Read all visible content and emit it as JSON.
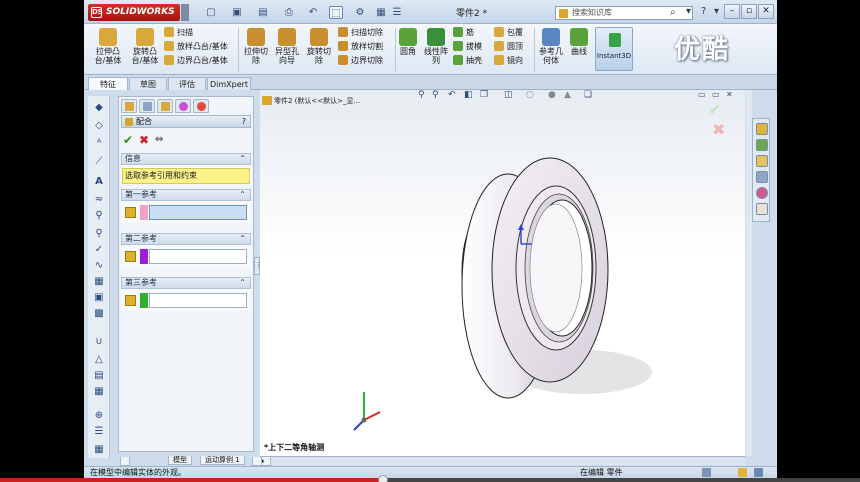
{
  "app": {
    "name": "SOLIDWORKS",
    "document_title": "零件2 *",
    "search_placeholder": "搜索知识库"
  },
  "window_controls": {
    "minimize": "–",
    "restore": "▫",
    "close": "✕"
  },
  "ribbon": {
    "extrude_boss": "拉伸凸\n台/基体",
    "revolve_boss": "旋转凸\n台/基体",
    "sweep": "扫描",
    "loft_boss": "放样凸台/基体",
    "boundary_boss": "边界凸台/基体",
    "extrude_cut": "拉伸切\n除",
    "hole_wizard": "异型孔\n向导",
    "revolve_cut": "旋转切\n除",
    "swept_cut": "扫描切除",
    "lofted_cut": "放样切割",
    "boundary_cut": "边界切除",
    "fillet": "圆角",
    "linear_pattern": "线性阵\n列",
    "rib": "筋",
    "draft": "拔模",
    "shell": "抽壳",
    "wrap": "包覆",
    "intersect": "圆顶",
    "mirror": "镜向",
    "ref_geometry": "参考几\n何体",
    "curves": "曲线",
    "instant3d": "Instant3D"
  },
  "watermark": "优酷",
  "tabs": [
    {
      "label": "特征",
      "active": true
    },
    {
      "label": "草图",
      "active": false
    },
    {
      "label": "评估",
      "active": false
    },
    {
      "label": "DimXpert",
      "active": false
    }
  ],
  "property_manager": {
    "title": "配合",
    "help": "?",
    "ok": "✔",
    "cancel": "✖",
    "pin": "⇔",
    "groups": {
      "info": {
        "title": "信息",
        "message": "选取参考引用和约束"
      },
      "first_ref": {
        "title": "第一参考",
        "color": "#f2a0c8"
      },
      "second_ref": {
        "title": "第二参考",
        "color": "#9a1fd6"
      },
      "third_ref": {
        "title": "第三参考",
        "color": "#2fae2f"
      }
    }
  },
  "viewport": {
    "tree_root": "零件2  (默认<<默认>_显...",
    "view_name": "*上下二等角轴测"
  },
  "bottom_tabs": [
    "模型",
    "运动算例 1"
  ],
  "status": {
    "left": "在模型中编辑实体的外观。",
    "right": "在编辑 零件"
  },
  "video_progress": 0.445
}
